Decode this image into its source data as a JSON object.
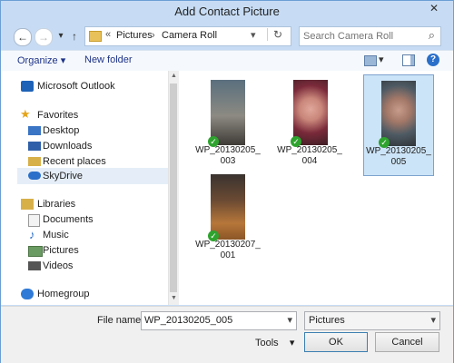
{
  "window": {
    "title": "Add Contact Picture",
    "close_glyph": "✕"
  },
  "nav_buttons": {
    "back": "←",
    "forward": "→",
    "dropdown": "▾",
    "up": "↑"
  },
  "address": {
    "prefix": "«",
    "parts": [
      "Pictures",
      "Camera Roll"
    ],
    "separator": "›",
    "dropdown": "▾",
    "refresh": "↻"
  },
  "search": {
    "placeholder": "Search Camera Roll",
    "icon": "⌕"
  },
  "toolbar": {
    "organize": "Organize",
    "organize_arrow": "▾",
    "new_folder": "New folder",
    "view_arrow": "▾",
    "help": "?"
  },
  "sidebar": {
    "outlook": "Microsoft Outlook",
    "favorites": {
      "label": "Favorites",
      "items": [
        "Desktop",
        "Downloads",
        "Recent places",
        "SkyDrive"
      ]
    },
    "libraries": {
      "label": "Libraries",
      "items": [
        "Documents",
        "Music",
        "Pictures",
        "Videos"
      ]
    },
    "homegroup": "Homegroup"
  },
  "files": [
    {
      "name": "WP_20130205_003",
      "selected": false
    },
    {
      "name": "WP_20130205_004",
      "selected": false
    },
    {
      "name": "WP_20130205_005",
      "selected": true
    },
    {
      "name": "WP_20130207_001",
      "selected": false
    }
  ],
  "bottom": {
    "filename_label": "File name:",
    "filename_value": "WP_20130205_005",
    "filter_value": "Pictures",
    "tools_label": "Tools",
    "tools_arrow": "▾",
    "ok_label": "OK",
    "cancel_label": "Cancel"
  },
  "colors": {
    "accent": "#cce4f7",
    "accent_border": "#7da2ce",
    "check": "#2ea32e",
    "chrome": "#c7dcf4"
  }
}
